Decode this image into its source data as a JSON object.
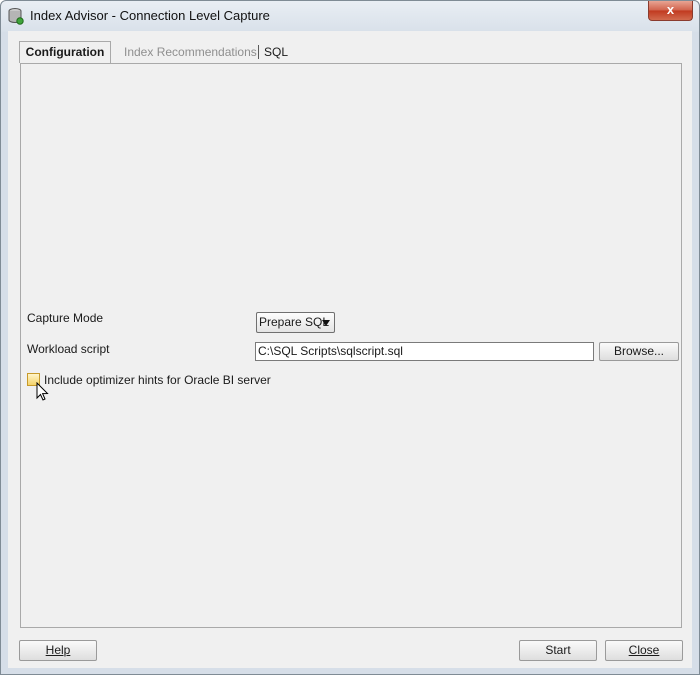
{
  "window": {
    "title": "Index Advisor - Connection Level Capture",
    "close_glyph": "x"
  },
  "tabs": [
    {
      "label": "Configuration",
      "state": "active"
    },
    {
      "label": "Index Recommendations",
      "state": "disabled"
    },
    {
      "label": "SQL",
      "state": "enabled"
    }
  ],
  "form": {
    "capture_mode_label": "Capture Mode",
    "capture_mode_value": "Prepare SQL",
    "workload_label": "Workload script",
    "workload_value": "C:\\SQL Scripts\\sqlscript.sql",
    "browse_label": "Browse...",
    "checkbox_label": "Include optimizer hints for Oracle BI server",
    "checkbox_checked": false
  },
  "footer": {
    "help_label": "Help",
    "start_label": "Start",
    "close_label": "Close"
  },
  "colors": {
    "close_button": "#c0391f",
    "checkbox_highlight": "#f5d36a"
  }
}
